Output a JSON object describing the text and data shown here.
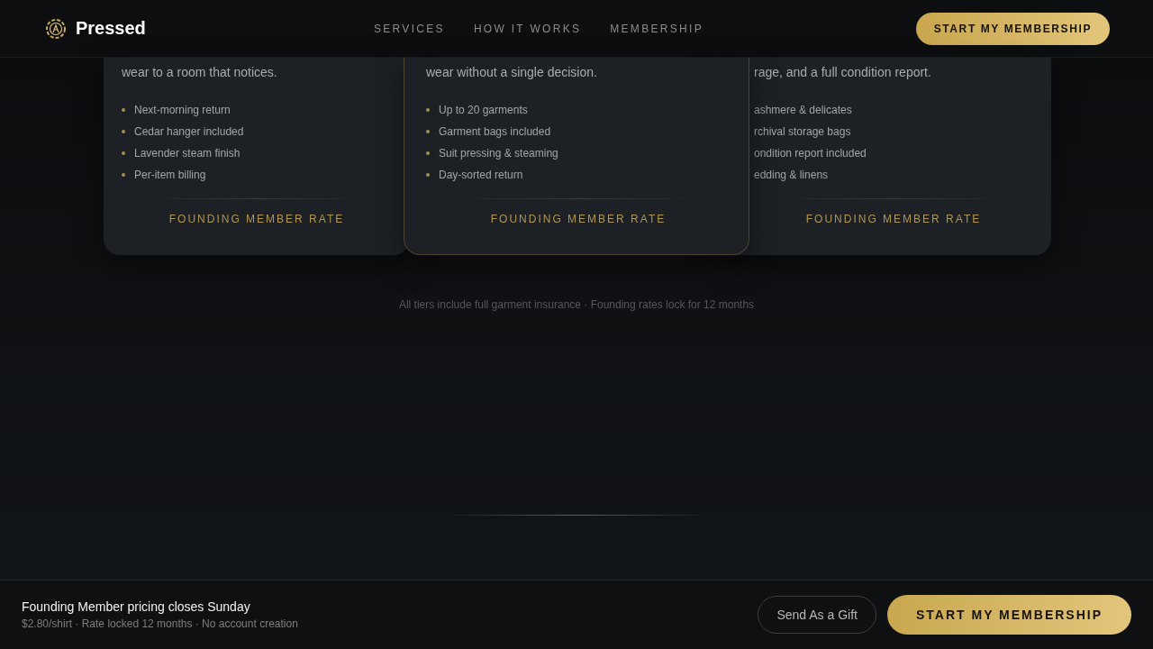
{
  "header": {
    "brand": "Pressed",
    "nav": [
      {
        "label": "SERVICES"
      },
      {
        "label": "HOW IT WORKS"
      },
      {
        "label": "MEMBERSHIP"
      }
    ],
    "cta": "START MY MEMBERSHIP"
  },
  "cards": [
    {
      "featured": false,
      "description": "wear to a room that notices.",
      "features": [
        {
          "text": "Next-morning return",
          "bullet": true
        },
        {
          "text": "Cedar hanger included",
          "bullet": true
        },
        {
          "text": "Lavender steam finish",
          "bullet": true
        },
        {
          "text": "Per-item billing",
          "bullet": true
        }
      ],
      "rate": "FOUNDING MEMBER RATE"
    },
    {
      "featured": true,
      "description": "wear without a single decision.",
      "features": [
        {
          "text": "Up to 20 garments",
          "bullet": true
        },
        {
          "text": "Garment bags included",
          "bullet": true
        },
        {
          "text": "Suit pressing & steaming",
          "bullet": true
        },
        {
          "text": "Day-sorted return",
          "bullet": true
        }
      ],
      "rate": "FOUNDING MEMBER RATE"
    },
    {
      "featured": false,
      "description": "rage, and a full condition report.",
      "features": [
        {
          "text": "ashmere & delicates",
          "bullet": false
        },
        {
          "text": "rchival storage bags",
          "bullet": false
        },
        {
          "text": "ondition report included",
          "bullet": false
        },
        {
          "text": "edding & linens",
          "bullet": false
        }
      ],
      "rate": "FOUNDING MEMBER RATE"
    }
  ],
  "footnote": "All tiers include full garment insurance · Founding rates lock for 12 months",
  "bottom_bar": {
    "title": "Founding Member pricing closes Sunday",
    "subtitle": "$2.80/shirt · Rate locked 12 months · No account creation",
    "gift_button": "Send As a Gift",
    "cta": "START MY MEMBERSHIP"
  }
}
